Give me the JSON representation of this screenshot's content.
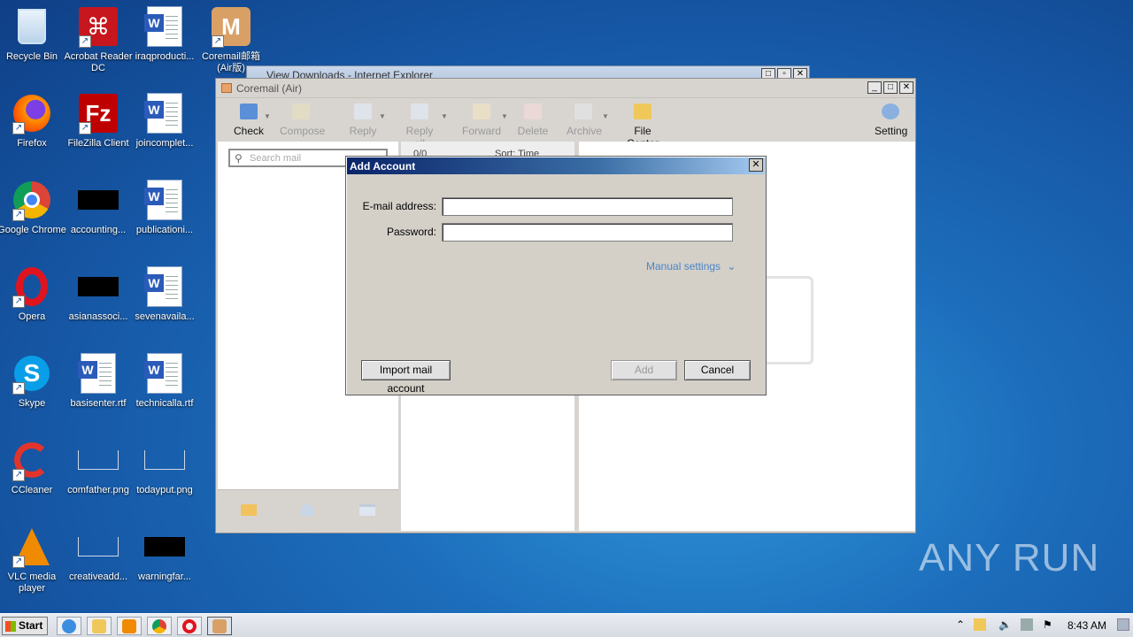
{
  "desktop": {
    "icons": [
      {
        "label": "Recycle Bin",
        "icon": "recycle-bin-icon"
      },
      {
        "label": "Acrobat Reader DC",
        "icon": "acrobat-icon"
      },
      {
        "label": "iraqproducti...",
        "icon": "word-doc-icon"
      },
      {
        "label": "Coremail邮箱 (Air版)",
        "icon": "coremail-icon"
      },
      {
        "label": "Firefox",
        "icon": "firefox-icon"
      },
      {
        "label": "FileZilla Client",
        "icon": "filezilla-icon"
      },
      {
        "label": "joincomplet...",
        "icon": "word-doc-icon"
      },
      {
        "label": "Google Chrome",
        "icon": "chrome-icon"
      },
      {
        "label": "accounting...",
        "icon": "blacked-file-icon"
      },
      {
        "label": "publicationi...",
        "icon": "word-doc-icon"
      },
      {
        "label": "Opera",
        "icon": "opera-icon"
      },
      {
        "label": "asianassoci...",
        "icon": "blacked-file-icon"
      },
      {
        "label": "sevenavaila...",
        "icon": "word-doc-icon"
      },
      {
        "label": "Skype",
        "icon": "skype-icon"
      },
      {
        "label": "basisenter.rtf",
        "icon": "word-doc-icon"
      },
      {
        "label": "technicalla.rtf",
        "icon": "word-doc-icon"
      },
      {
        "label": "CCleaner",
        "icon": "ccleaner-icon"
      },
      {
        "label": "comfather.png",
        "icon": "image-file-icon"
      },
      {
        "label": "todayput.png",
        "icon": "image-file-icon"
      },
      {
        "label": "VLC media player",
        "icon": "vlc-icon"
      },
      {
        "label": "creativeadd...",
        "icon": "image-file-icon"
      },
      {
        "label": "warningfar...",
        "icon": "blacked-file-icon"
      }
    ]
  },
  "ie_window": {
    "title": "View Downloads - Internet Explorer"
  },
  "coremail": {
    "title": "Coremail (Air)",
    "toolbar": {
      "check": "Check",
      "compose": "Compose",
      "reply": "Reply",
      "reply_all": "Reply all",
      "forward": "Forward",
      "delete": "Delete",
      "archive": "Archive",
      "file_center": "File Center",
      "setting": "Setting"
    },
    "search_placeholder": "Search mail",
    "list_header": {
      "count": "0/0",
      "sort": "Sort: Time"
    }
  },
  "dialog": {
    "title": "Add Account",
    "email_label": "E-mail address:",
    "email_value": "",
    "password_label": "Password:",
    "password_value": "",
    "manual_settings": "Manual settings",
    "import_button": "Import mail account",
    "add_button": "Add",
    "cancel_button": "Cancel"
  },
  "taskbar": {
    "start_label": "Start",
    "clock": "8:43 AM"
  },
  "watermark": "ANY RUN"
}
